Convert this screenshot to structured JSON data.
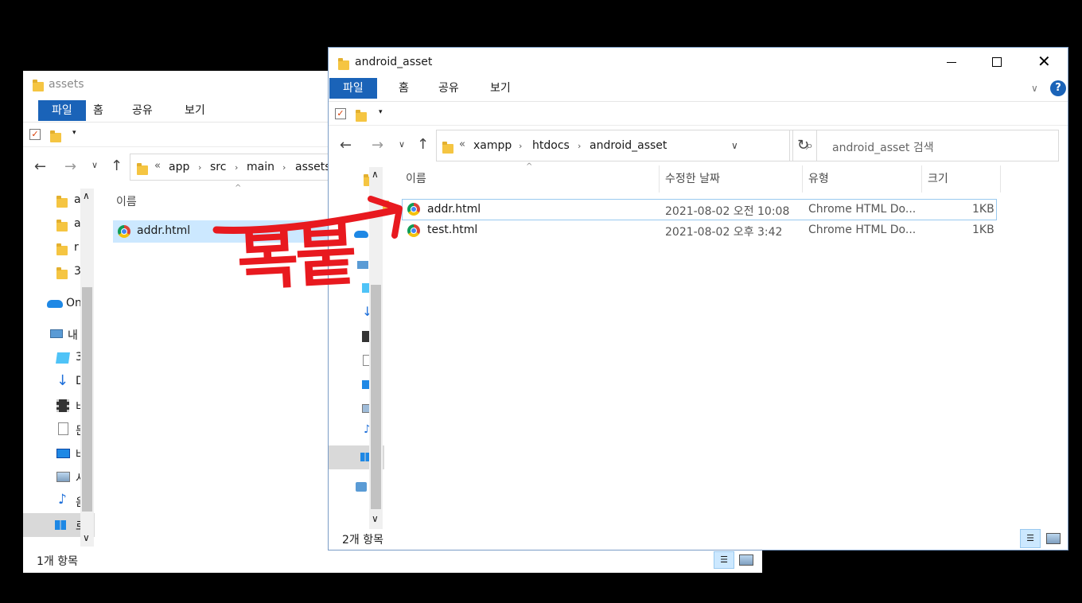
{
  "left_window": {
    "title": "assets",
    "ribbon": {
      "file": "파일",
      "home": "홈",
      "share": "공유",
      "view": "보기"
    },
    "breadcrumb": [
      "app",
      "src",
      "main",
      "assets"
    ],
    "overflow": "«",
    "column_name": "이름",
    "sidebar_items": [
      "a",
      "a",
      "r",
      "3",
      "On",
      "내",
      "3",
      "D",
      "비",
      "문",
      "바",
      "사",
      "음",
      "로"
    ],
    "files": [
      {
        "name": "addr.html"
      }
    ],
    "status": "1개 항목"
  },
  "right_window": {
    "title": "android_asset",
    "ribbon": {
      "file": "파일",
      "home": "홈",
      "share": "공유",
      "view": "보기"
    },
    "breadcrumb": [
      "xampp",
      "htdocs",
      "android_asset"
    ],
    "overflow": "«",
    "search_placeholder": "android_asset 검색",
    "columns": {
      "name": "이름",
      "modified": "수정한 날짜",
      "type": "유형",
      "size": "크기"
    },
    "files": [
      {
        "name": "addr.html",
        "modified": "2021-08-02 오전 10:08",
        "type": "Chrome HTML Do...",
        "size": "1KB"
      },
      {
        "name": "test.html",
        "modified": "2021-08-02 오후 3:42",
        "type": "Chrome HTML Do...",
        "size": "1KB"
      }
    ],
    "status": "2개 항목",
    "help": "?"
  },
  "annotation": {
    "text": "복붙",
    "color": "#e8191f"
  },
  "colors": {
    "accent": "#1a63b8",
    "selection": "#cce8ff",
    "annotation": "#e8191f"
  },
  "icons": [
    "folder-icon",
    "chrome-icon",
    "onedrive-icon",
    "pc-icon",
    "3d-objects-icon",
    "download-icon",
    "video-icon",
    "document-icon",
    "desktop-icon",
    "pictures-icon",
    "music-icon",
    "windows-drive-icon",
    "network-icon",
    "refresh-icon",
    "search-icon",
    "help-icon",
    "details-view-icon",
    "large-icons-view-icon"
  ]
}
